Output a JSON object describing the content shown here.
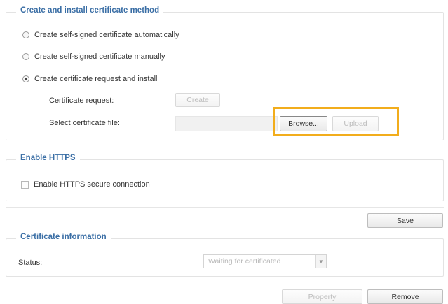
{
  "method": {
    "legend": "Create and install certificate method",
    "options": [
      {
        "label": "Create self-signed certificate automatically",
        "selected": false
      },
      {
        "label": "Create self-signed certificate manually",
        "selected": false
      },
      {
        "label": "Create certificate request and install",
        "selected": true
      }
    ],
    "certificate_request_label": "Certificate request:",
    "create_button": "Create",
    "select_file_label": "Select certificate file:",
    "file_input_value": "",
    "browse_button": "Browse...",
    "upload_button": "Upload"
  },
  "https": {
    "legend": "Enable HTTPS",
    "checkbox_label": "Enable HTTPS secure connection",
    "checked": false
  },
  "save_button": "Save",
  "info": {
    "legend": "Certificate information",
    "status_label": "Status:",
    "status_value": "Waiting for certificated"
  },
  "property_button": "Property",
  "remove_button": "Remove",
  "colors": {
    "legend": "#3a6ea5",
    "highlight": "#f2ad1c"
  }
}
